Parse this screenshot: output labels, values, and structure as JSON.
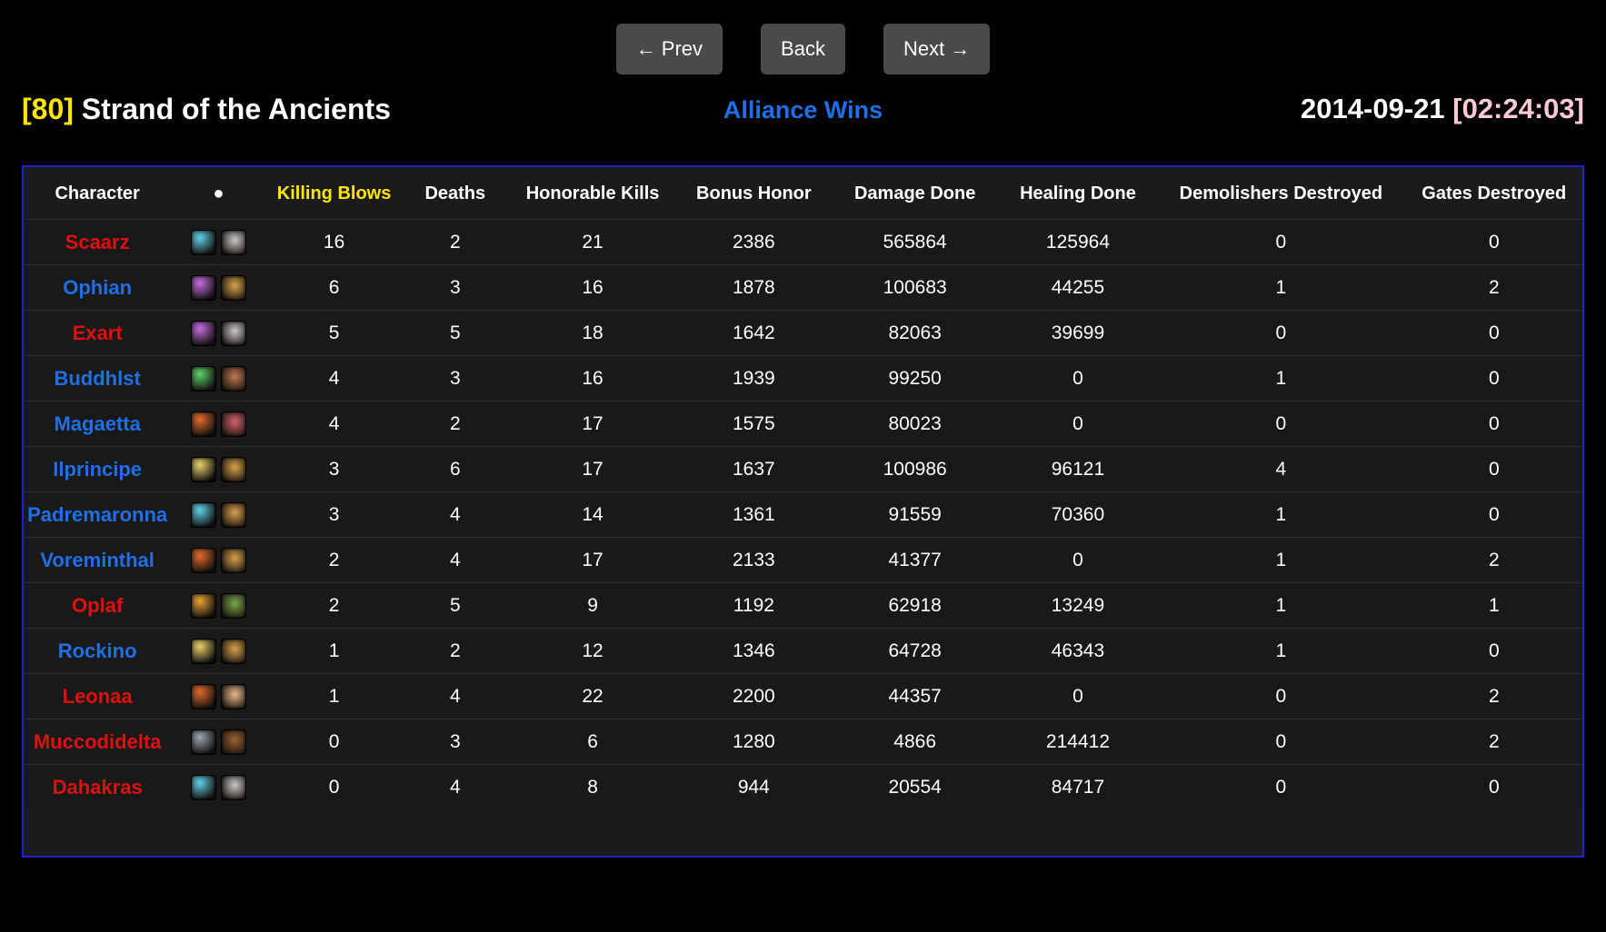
{
  "nav": {
    "prev_label": "← Prev",
    "back_label": "Back",
    "next_label": "Next →"
  },
  "header": {
    "level": "[80]",
    "battleground": "Strand of the Ancients",
    "winner": "Alliance Wins",
    "date": "2014-09-21",
    "duration": "[02:24:03]"
  },
  "colors": {
    "level_yellow": "#ffe600",
    "winner_blue": "#1f6fe8",
    "duration_pink": "#ffc9d6",
    "table_border": "#2222cc",
    "alliance_name": "#1f6fe8",
    "horde_name": "#e01010",
    "highlight_header": "#ffe600"
  },
  "table": {
    "columns": [
      "Character",
      "●",
      "Killing Blows",
      "Deaths",
      "Honorable Kills",
      "Bonus Honor",
      "Damage Done",
      "Healing Done",
      "Demolishers Destroyed",
      "Gates Destroyed"
    ],
    "sorted_column": "Killing Blows",
    "rows": [
      {
        "name": "Scaarz",
        "faction": "horde",
        "class_icon": "frost-dk-icon",
        "race_icon": "undead-male-icon",
        "class_color": "#5fd0e8",
        "race_color": "#c9c9c9",
        "killing_blows": 16,
        "deaths": 2,
        "honorable_kills": 21,
        "bonus_honor": 2386,
        "damage_done": 565864,
        "healing_done": 125964,
        "demolishers_destroyed": 0,
        "gates_destroyed": 0
      },
      {
        "name": "Ophian",
        "faction": "alliance",
        "class_icon": "shadow-priest-icon",
        "race_icon": "dwarf-male-icon",
        "class_color": "#c46be0",
        "race_color": "#d7a24a",
        "killing_blows": 6,
        "deaths": 3,
        "honorable_kills": 16,
        "bonus_honor": 1878,
        "damage_done": 100683,
        "healing_done": 44255,
        "demolishers_destroyed": 1,
        "gates_destroyed": 2
      },
      {
        "name": "Exart",
        "faction": "horde",
        "class_icon": "shadow-priest-icon",
        "race_icon": "undead-male-icon",
        "class_color": "#c46be0",
        "race_color": "#c9c9c9",
        "killing_blows": 5,
        "deaths": 5,
        "honorable_kills": 18,
        "bonus_honor": 1642,
        "damage_done": 82063,
        "healing_done": 39699,
        "demolishers_destroyed": 0,
        "gates_destroyed": 0
      },
      {
        "name": "Buddhlst",
        "faction": "alliance",
        "class_icon": "hunter-marks-icon",
        "race_icon": "human-male-icon",
        "class_color": "#5fd06a",
        "race_color": "#c07a52",
        "killing_blows": 4,
        "deaths": 3,
        "honorable_kills": 16,
        "bonus_honor": 1939,
        "damage_done": 99250,
        "healing_done": 0,
        "demolishers_destroyed": 1,
        "gates_destroyed": 0
      },
      {
        "name": "Magaetta",
        "faction": "alliance",
        "class_icon": "fire-mage-icon",
        "race_icon": "gnome-female-icon",
        "class_color": "#e06a2a",
        "race_color": "#d4636b",
        "killing_blows": 4,
        "deaths": 2,
        "honorable_kills": 17,
        "bonus_honor": 1575,
        "damage_done": 80023,
        "healing_done": 0,
        "demolishers_destroyed": 0,
        "gates_destroyed": 0
      },
      {
        "name": "Ilprincipe",
        "faction": "alliance",
        "class_icon": "holy-paladin-icon",
        "race_icon": "dwarf-male-icon",
        "class_color": "#e8cf6a",
        "race_color": "#d7a24a",
        "killing_blows": 3,
        "deaths": 6,
        "honorable_kills": 17,
        "bonus_honor": 1637,
        "damage_done": 100986,
        "healing_done": 96121,
        "demolishers_destroyed": 4,
        "gates_destroyed": 0
      },
      {
        "name": "Padremaronna",
        "faction": "alliance",
        "class_icon": "frost-dk-icon",
        "race_icon": "dwarf-male-icon",
        "class_color": "#5fd0e8",
        "race_color": "#d7a24a",
        "killing_blows": 3,
        "deaths": 4,
        "honorable_kills": 14,
        "bonus_honor": 1361,
        "damage_done": 91559,
        "healing_done": 70360,
        "demolishers_destroyed": 1,
        "gates_destroyed": 0
      },
      {
        "name": "Voreminthal",
        "faction": "alliance",
        "class_icon": "fire-mage-icon",
        "race_icon": "dwarf-male-icon",
        "class_color": "#e06a2a",
        "race_color": "#d7a24a",
        "killing_blows": 2,
        "deaths": 4,
        "honorable_kills": 17,
        "bonus_honor": 2133,
        "damage_done": 41377,
        "healing_done": 0,
        "demolishers_destroyed": 1,
        "gates_destroyed": 2
      },
      {
        "name": "Oplaf",
        "faction": "horde",
        "class_icon": "fire-warlock-icon",
        "race_icon": "orc-male-icon",
        "class_color": "#e8a030",
        "race_color": "#7aa64a",
        "killing_blows": 2,
        "deaths": 5,
        "honorable_kills": 9,
        "bonus_honor": 1192,
        "damage_done": 62918,
        "healing_done": 13249,
        "demolishers_destroyed": 1,
        "gates_destroyed": 1
      },
      {
        "name": "Rockino",
        "faction": "alliance",
        "class_icon": "holy-paladin-icon",
        "race_icon": "dwarf-male-icon",
        "class_color": "#e8cf6a",
        "race_color": "#d7a24a",
        "killing_blows": 1,
        "deaths": 2,
        "honorable_kills": 12,
        "bonus_honor": 1346,
        "damage_done": 64728,
        "healing_done": 46343,
        "demolishers_destroyed": 1,
        "gates_destroyed": 0
      },
      {
        "name": "Leonaa",
        "faction": "horde",
        "class_icon": "fire-mage-icon",
        "race_icon": "bloodelf-female-icon",
        "class_color": "#e06a2a",
        "race_color": "#e8b88a",
        "killing_blows": 1,
        "deaths": 4,
        "honorable_kills": 22,
        "bonus_honor": 2200,
        "damage_done": 44357,
        "healing_done": 0,
        "demolishers_destroyed": 0,
        "gates_destroyed": 2
      },
      {
        "name": "Muccodidelta",
        "faction": "horde",
        "class_icon": "resto-shaman-icon",
        "race_icon": "tauren-male-icon",
        "class_color": "#9aa4b0",
        "race_color": "#9a6233",
        "killing_blows": 0,
        "deaths": 3,
        "honorable_kills": 6,
        "bonus_honor": 1280,
        "damage_done": 4866,
        "healing_done": 214412,
        "demolishers_destroyed": 0,
        "gates_destroyed": 2
      },
      {
        "name": "Dahakras",
        "faction": "horde",
        "class_icon": "frost-dk-icon",
        "race_icon": "undead-male-icon",
        "class_color": "#5fd0e8",
        "race_color": "#c9c9c9",
        "killing_blows": 0,
        "deaths": 4,
        "honorable_kills": 8,
        "bonus_honor": 944,
        "damage_done": 20554,
        "healing_done": 84717,
        "demolishers_destroyed": 0,
        "gates_destroyed": 0
      }
    ]
  }
}
